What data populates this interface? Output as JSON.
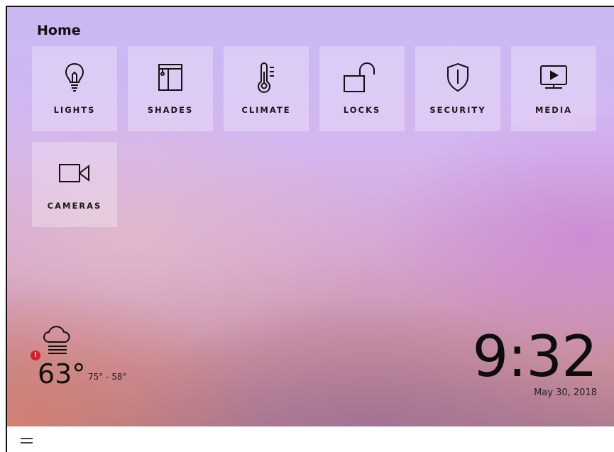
{
  "header": {
    "title": "Home"
  },
  "tiles": [
    {
      "label": "LIGHTS",
      "icon": "lightbulb-icon"
    },
    {
      "label": "SHADES",
      "icon": "shades-icon"
    },
    {
      "label": "CLIMATE",
      "icon": "thermometer-icon"
    },
    {
      "label": "LOCKS",
      "icon": "unlocked-padlock-icon"
    },
    {
      "label": "SECURITY",
      "icon": "shield-icon"
    },
    {
      "label": "MEDIA",
      "icon": "tv-play-icon"
    },
    {
      "label": "CAMERAS",
      "icon": "video-camera-icon"
    }
  ],
  "weather": {
    "icon": "cloud-fog-icon",
    "alert_icon": "alert-icon",
    "alert_glyph": "!",
    "temperature": "63°",
    "range": "75° - 58°"
  },
  "clock": {
    "time": "9:32",
    "date": "May 30, 2018"
  },
  "bottom_bar": {
    "menu_icon": "hamburger-menu-icon"
  },
  "colors": {
    "alert": "#d21f2b",
    "tile_background": "rgba(255,255,255,0.28)",
    "text": "#111111"
  }
}
